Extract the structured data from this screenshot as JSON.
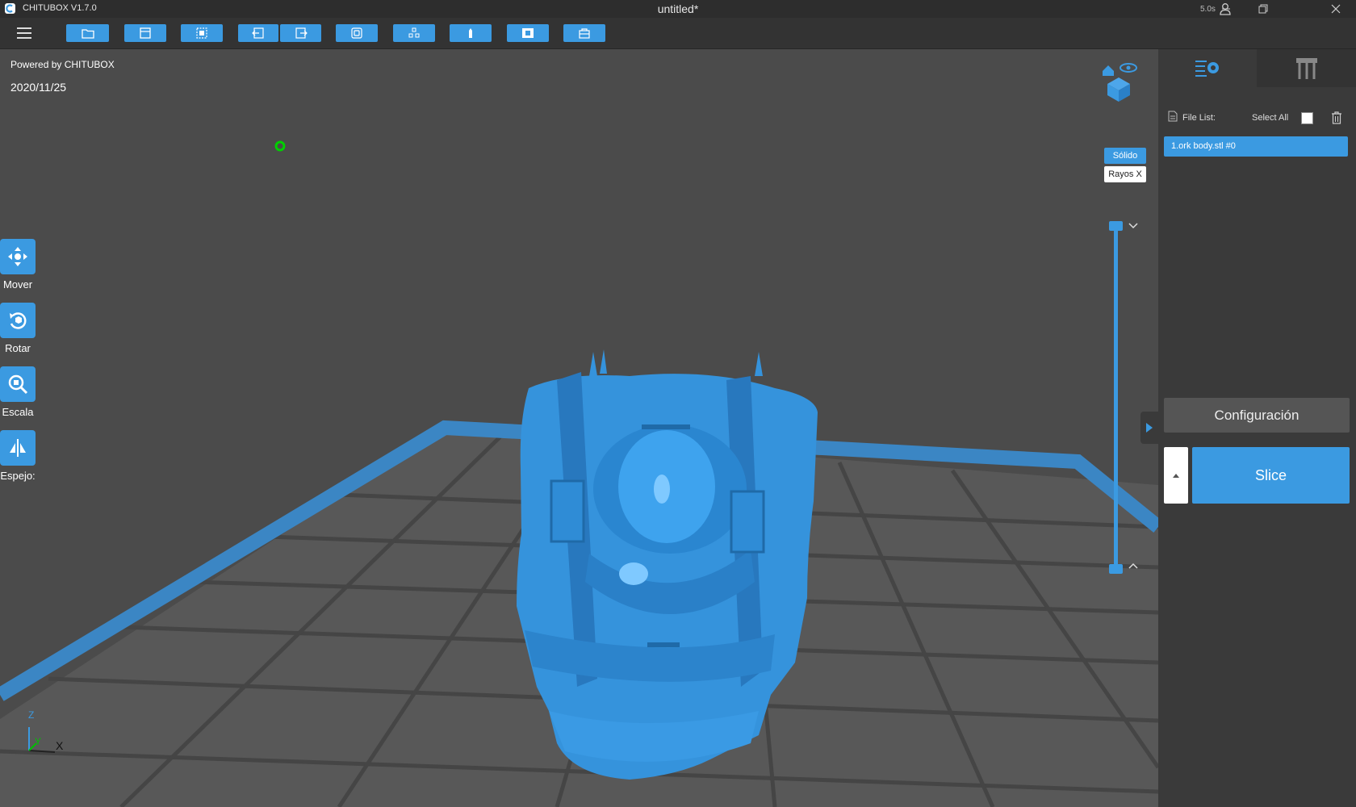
{
  "window": {
    "app_name": "CHITUBOX V1.7.0",
    "doc_title": "untitled*",
    "fps": "5.0s"
  },
  "toolbar": {
    "icons": [
      "open-file-icon",
      "save-icon",
      "select-icon",
      "undo-icon",
      "redo-icon",
      "copy-icon",
      "arrange-icon",
      "support-icon",
      "hollow-icon",
      "dig-hole-icon"
    ]
  },
  "viewport": {
    "powered_by": "Powered by CHITUBOX",
    "date": "2020/11/25",
    "axis_x": "X",
    "axis_y": "Y",
    "axis_z": "Z"
  },
  "left_tools": [
    {
      "label": "Mover",
      "icon": "move-icon"
    },
    {
      "label": "Rotar",
      "icon": "rotate-icon"
    },
    {
      "label": "Escala",
      "icon": "scale-icon"
    },
    {
      "label": "Espejo:",
      "icon": "mirror-icon"
    }
  ],
  "view_modes": {
    "solid": "Sólido",
    "xray": "Rayos X",
    "active": "solid"
  },
  "sidebar": {
    "file_list_label": "File List:",
    "select_all_label": "Select All",
    "files": [
      "1.ork body.stl #0"
    ],
    "config_button": "Configuración",
    "slice_button": "Slice"
  },
  "colors": {
    "accent": "#3b9ae1",
    "background": "#4b4b4b",
    "sidebar": "#3a3a3a"
  }
}
